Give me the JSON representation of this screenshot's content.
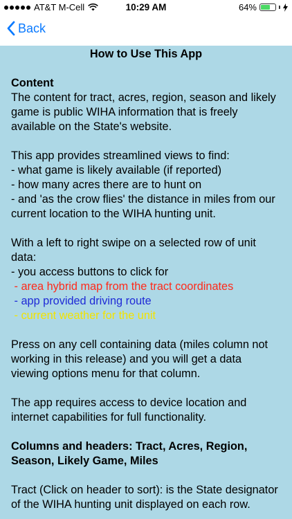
{
  "status_bar": {
    "carrier": "AT&T M-Cell",
    "time": "10:29 AM",
    "battery_percent": "64%",
    "battery_level": 0.64,
    "battery_color": "#4cd964"
  },
  "nav": {
    "back_label": "Back",
    "accent": "#0a7aff"
  },
  "page": {
    "title": "How to Use This App",
    "content_heading": "Content",
    "content_text": "The content for tract, acres, region, season and likely game is public WIHA information that is freely available on the State's website.",
    "views_intro": "This app provides streamlined views to find:",
    "views": [
      "- what game is likely available (if reported)",
      "- how many acres there are to hunt on",
      "- and 'as the crow flies' the distance in miles from our current location to the WIHA hunting unit."
    ],
    "swipe_intro": "With a left to right swipe on a selected row of unit data:",
    "swipe_buttons_intro": "- you access buttons to click for",
    "swipe_options": [
      {
        "text": " - area hybrid map from the tract coordinates",
        "color": "#ff2a1a"
      },
      {
        "text": " - app provided driving route",
        "color": "#1f2ad6"
      },
      {
        "text": " - current weather for the unit",
        "color": "#f2e300"
      }
    ],
    "press_text": "Press on any cell containing data (miles column not working in this release) and you will get a data viewing options menu for that column.",
    "requires_text": "The app requires access to device location and internet capabilities for full functionality.",
    "columns_heading": "Columns and headers:  Tract, Acres, Region, Season, Likely Game, Miles",
    "tract_text": "Tract (Click on header to sort): is the State designator of the WIHA hunting unit displayed on each row.",
    "background_color": "#add8e6"
  }
}
